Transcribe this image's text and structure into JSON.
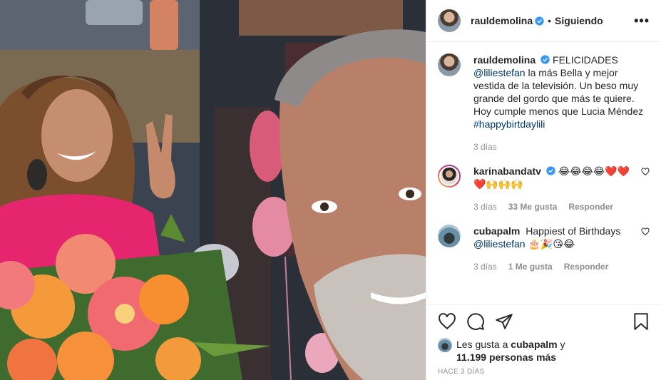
{
  "header": {
    "username": "rauldemolina",
    "separator": "•",
    "follow_label": "Siguiendo",
    "more_label": "•••"
  },
  "caption": {
    "username": "rauldemolina",
    "text_before": "FELICIDADES",
    "mention": "@liliestefan",
    "text_after": " la más Bella y mejor vestida de la televisión. Un beso muy grande del gordo que más te quiere. Hoy cumple menos que Lucia Méndez ",
    "hashtag": "#happybirtdaylili",
    "time": "3 días"
  },
  "comments": [
    {
      "username": "karinabandatv",
      "text": "😂😂😂😂❤️❤️❤️🙌🙌🙌",
      "time": "3 días",
      "likes": "33 Me gusta",
      "reply": "Responder"
    },
    {
      "username": "cubapalm",
      "text": "Happiest of Birthdays",
      "mention": "@liliestefan",
      "emoji": "🎂🎉😘😂",
      "time": "3 días",
      "likes": "1 Me gusta",
      "reply": "Responder"
    }
  ],
  "likes_line": {
    "prefix": "Les gusta a ",
    "user": "cubapalm",
    "mid": " y",
    "count": "11.199 personas más"
  },
  "posted_ago": "HACE 3 DÍAS",
  "colors": {
    "link": "#00376b",
    "verified": "#3897f0",
    "muted": "#8e8e8e"
  }
}
